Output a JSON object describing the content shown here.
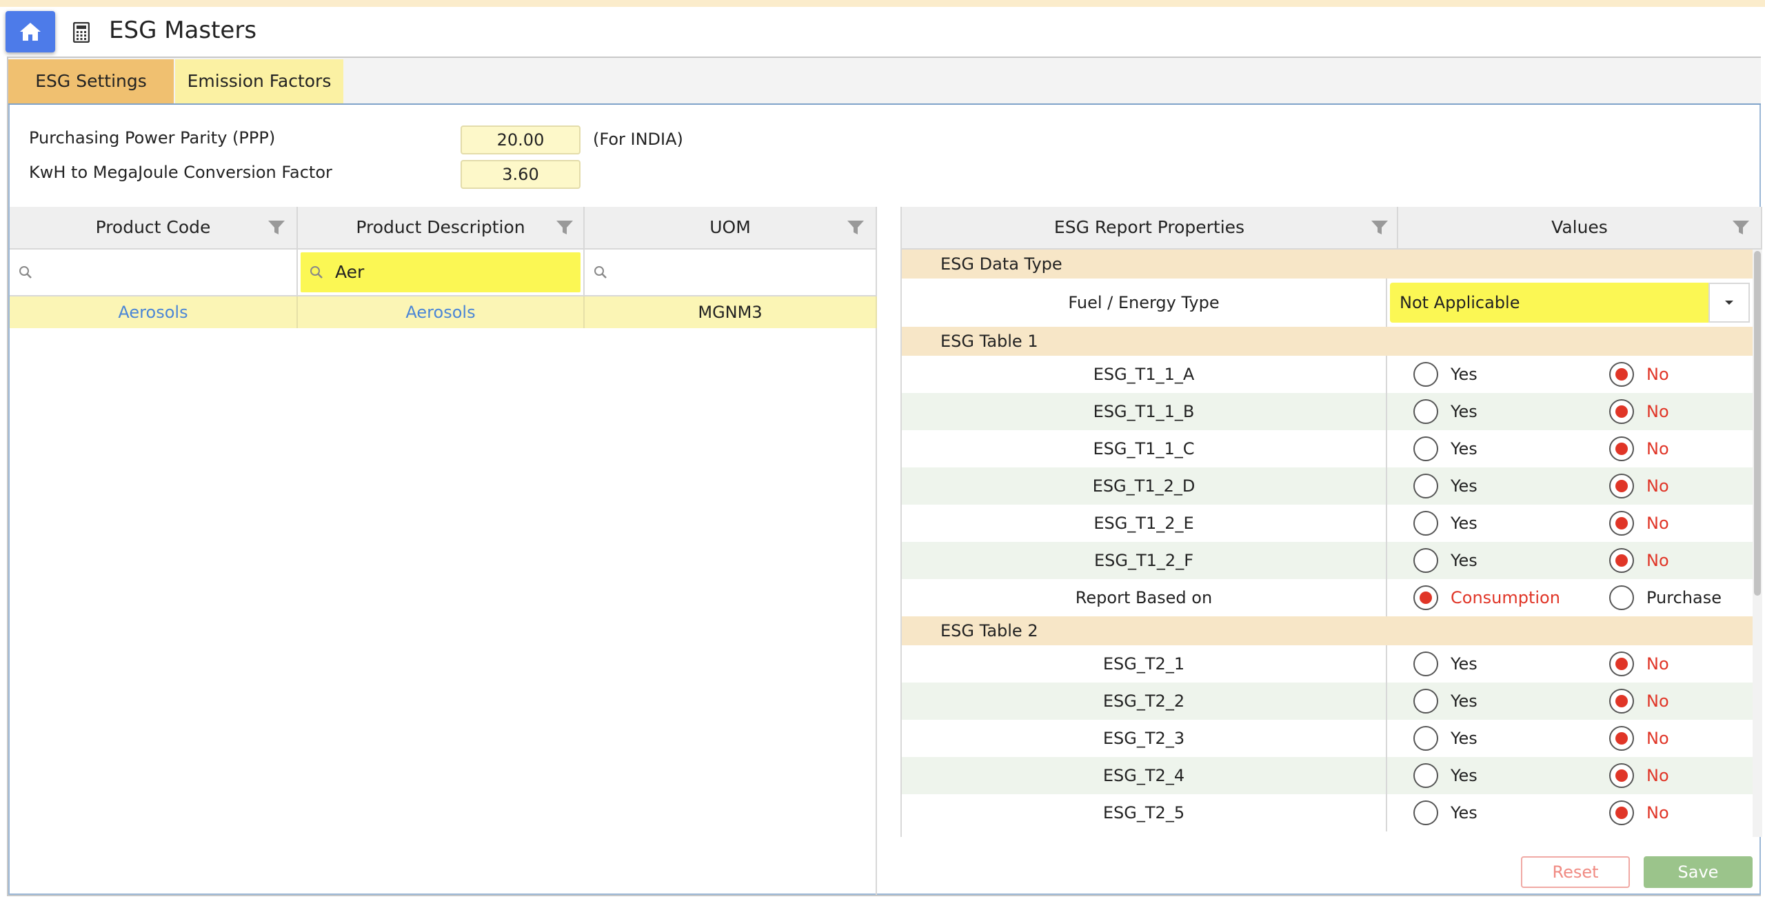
{
  "app": {
    "title": "ESG Masters"
  },
  "tabs": [
    {
      "label": "ESG Settings",
      "active": true
    },
    {
      "label": "Emission Factors",
      "active": false
    }
  ],
  "settings": {
    "ppp_label": "Purchasing Power Parity (PPP)",
    "ppp_value": "20.00",
    "ppp_note": "(For INDIA)",
    "kwh_label": "KwH to MegaJoule Conversion Factor",
    "kwh_value": "3.60"
  },
  "product_grid": {
    "columns": [
      "Product Code",
      "Product Description",
      "UOM"
    ],
    "filters": [
      "",
      "Aer",
      ""
    ],
    "rows": [
      {
        "code": "Aerosols",
        "description": "Aerosols",
        "uom": "MGNM3"
      }
    ]
  },
  "props_grid": {
    "columns": [
      "ESG Report Properties",
      "Values"
    ],
    "group_data_type": "ESG Data Type",
    "fuel_label": "Fuel / Energy Type",
    "fuel_value": "Not Applicable",
    "group_table1": "ESG Table 1",
    "table1_rows": [
      "ESG_T1_1_A",
      "ESG_T1_1_B",
      "ESG_T1_1_C",
      "ESG_T1_2_D",
      "ESG_T1_2_E",
      "ESG_T1_2_F"
    ],
    "report_based_label": "Report Based on",
    "report_options": [
      "Consumption",
      "Purchase"
    ],
    "report_selected": "Consumption",
    "group_table2": "ESG Table 2",
    "table2_rows": [
      "ESG_T2_1",
      "ESG_T2_2",
      "ESG_T2_3",
      "ESG_T2_4",
      "ESG_T2_5"
    ],
    "yes_label": "Yes",
    "no_label": "No",
    "selected_value": "No"
  },
  "actions": {
    "reset": "Reset",
    "save": "Save"
  },
  "colors": {
    "accent": "#4d7be9",
    "selected_radio": "#e03527",
    "tab_active": "#f0c070",
    "highlight": "#fbf754"
  }
}
